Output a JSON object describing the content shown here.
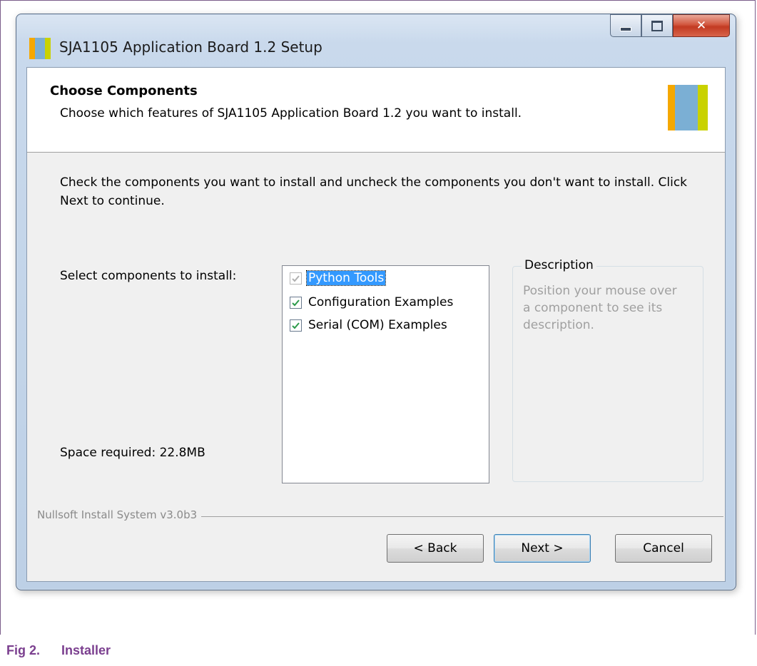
{
  "window": {
    "title": "SJA1105 Application Board 1.2 Setup"
  },
  "header": {
    "title": "Choose Components",
    "subtitle": "Choose which features of SJA1105 Application Board 1.2 you want to install."
  },
  "body": {
    "instructions": "Check the components you want to install and uncheck the components you don't want to install. Click Next to continue.",
    "select_label": "Select components to install:",
    "space_required": "Space required: 22.8MB"
  },
  "components": [
    {
      "label": "Python Tools",
      "checked": true,
      "disabled": true,
      "selected": true
    },
    {
      "label": "Configuration Examples",
      "checked": true,
      "disabled": false,
      "selected": false
    },
    {
      "label": "Serial (COM) Examples",
      "checked": true,
      "disabled": false,
      "selected": false
    }
  ],
  "description": {
    "title": "Description",
    "text": "Position your mouse over a component to see its description."
  },
  "footer": {
    "branding": "Nullsoft Install System v3.0b3"
  },
  "buttons": {
    "back": "< Back",
    "next": "Next >",
    "cancel": "Cancel"
  },
  "figure_caption": {
    "number": "Fig 2.",
    "title": "Installer"
  },
  "colors": {
    "logo_orange": "#f5a800",
    "logo_blue": "#7bafd4",
    "logo_green": "#c9d200",
    "caption_purple": "#7b3f8f",
    "selection_blue": "#3399ff"
  }
}
